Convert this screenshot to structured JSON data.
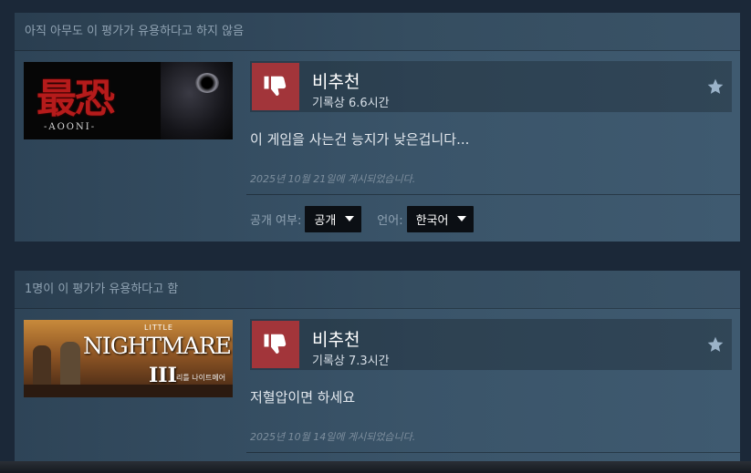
{
  "reviews": [
    {
      "helpful_text": "아직 아무도 이 평가가 유용하다고 하지 않음",
      "capsule": {
        "title_art": "最恐",
        "subtitle_art": "-AOONI-"
      },
      "verdict": "비추천",
      "hours": "기록상 6.6시간",
      "body": "이 게임을 사는건 능지가 낮은겁니다...",
      "posted": "2025년 10월 21일에 게시되었습니다.",
      "visibility_label": "공개 여부:",
      "visibility_value": "공개",
      "language_label": "언어:",
      "language_value": "한국어"
    },
    {
      "helpful_text": "1명이 이 평가가 유용하다고 함",
      "capsule": {
        "little_art": "LITTLE",
        "title_art": "NIGHTMARES",
        "numeral_art": "III",
        "kr_art": "리틀 나이트메어"
      },
      "verdict": "비추천",
      "hours": "기록상 7.3시간",
      "body": "저혈압이면 하세요",
      "posted": "2025년 10월 14일에 게시되었습니다."
    }
  ],
  "icons": {
    "thumb": "thumbs-down-icon",
    "star": "star-icon",
    "dropdown": "chevron-down-icon"
  },
  "colors": {
    "background": "#1b2838",
    "thumb_down": "#a2353a",
    "text_muted": "#8fa2b2"
  }
}
